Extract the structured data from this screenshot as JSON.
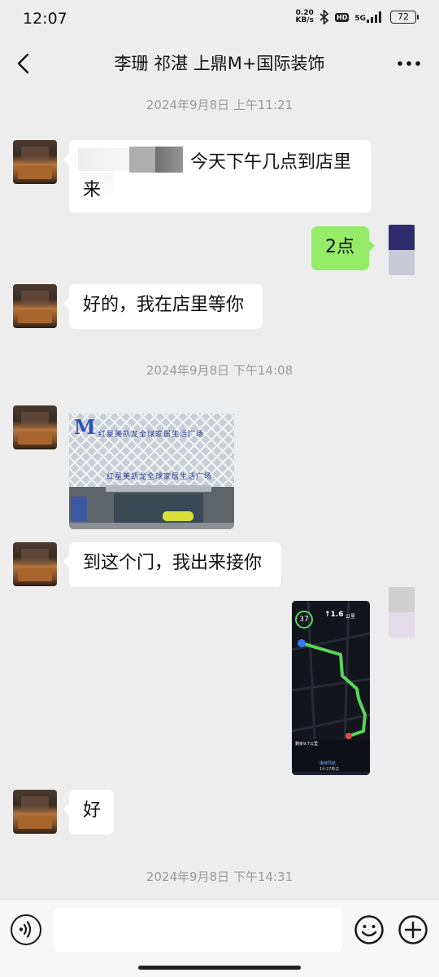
{
  "status_bar": {
    "time": "12:07",
    "net_speed_value": "0.20",
    "net_speed_unit": "KB/s",
    "hd_label": "HD",
    "signal_label": "5G",
    "battery": "72"
  },
  "nav": {
    "title": "李珊 祁湛 上鼎M+国际装饰",
    "back_icon": "chevron-left-icon",
    "more_icon": "more-horizontal-icon"
  },
  "messages": {
    "timestamp_1": "2024年9月8日 上午11:21",
    "msg_1_line1": "今天下午几点到店里",
    "msg_1_line2": "来",
    "msg_2": "2点",
    "msg_3": "好的，我在店里等你",
    "timestamp_2": "2024年9月8日 下午14:08",
    "msg_5": "到这个门，我出来接你",
    "msg_7": "好",
    "timestamp_3": "2024年9月8日 下午14:31"
  },
  "photo": {
    "sign_letter": "M",
    "sign_text": "红星美凯龙全球家居生活广场"
  },
  "nav_screenshot": {
    "speed": "37",
    "distance": "↑1.6",
    "distance_unit": "公里",
    "remaining": "剩余9.7公里",
    "exit_label": "继续导航",
    "eta": "14:27到达"
  },
  "input_bar": {
    "placeholder": "",
    "voice_icon": "voice-icon",
    "emoji_icon": "emoji-icon",
    "plus_icon": "plus-icon"
  },
  "colors": {
    "background": "#ededed",
    "bubble_left": "#ffffff",
    "bubble_right": "#95ec69",
    "timestamp": "#9a9a9a"
  }
}
